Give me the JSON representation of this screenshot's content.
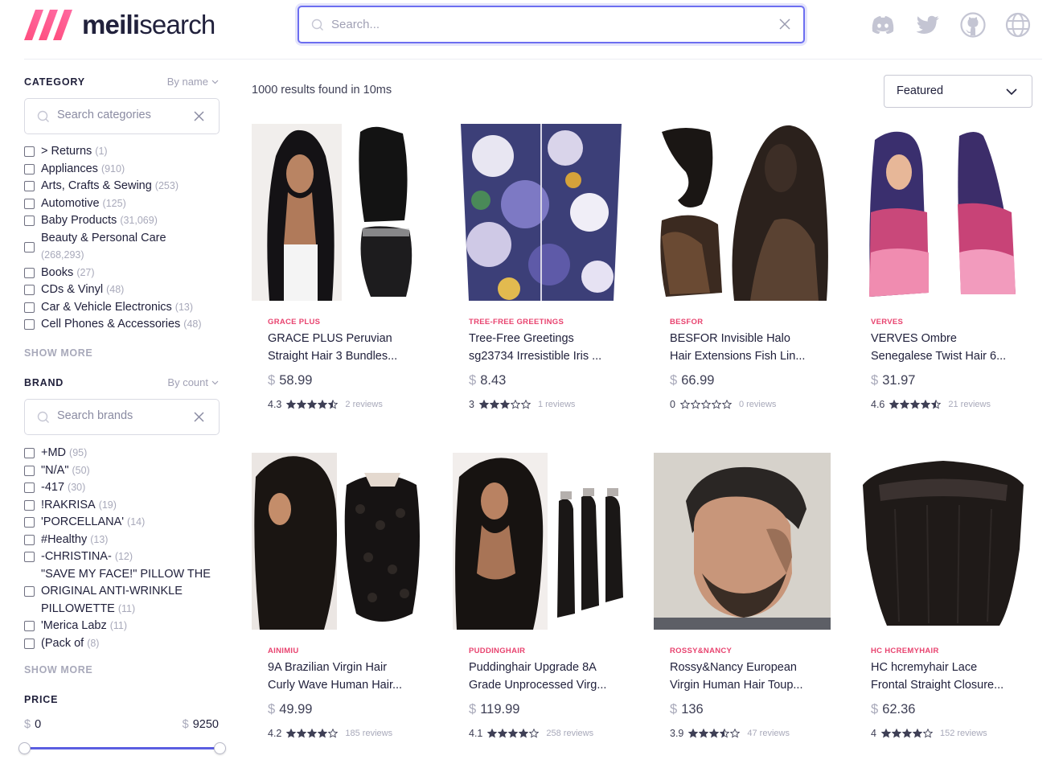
{
  "brand": {
    "wordmark_bold": "meili",
    "wordmark_light": "search",
    "colors": {
      "logo": "#ff5a8a",
      "accent": "#5b5ee1",
      "brand_text": "#e8436f"
    }
  },
  "search": {
    "placeholder": "Search...",
    "value": ""
  },
  "social": [
    {
      "icon": "discord-icon"
    },
    {
      "icon": "twitter-icon"
    },
    {
      "icon": "github-icon"
    },
    {
      "icon": "globe-icon"
    }
  ],
  "sidebar": {
    "category": {
      "title": "CATEGORY",
      "sort": "By name",
      "search_placeholder": "Search categories",
      "items": [
        {
          "label": "> Returns",
          "count": "(1)"
        },
        {
          "label": "Appliances",
          "count": "(910)"
        },
        {
          "label": "Arts, Crafts & Sewing",
          "count": "(253)"
        },
        {
          "label": "Automotive",
          "count": "(125)"
        },
        {
          "label": "Baby Products",
          "count": "(31,069)"
        },
        {
          "label": "Beauty & Personal Care",
          "count": "(268,293)"
        },
        {
          "label": "Books",
          "count": "(27)"
        },
        {
          "label": "CDs & Vinyl",
          "count": "(48)"
        },
        {
          "label": "Car & Vehicle Electronics",
          "count": "(13)"
        },
        {
          "label": "Cell Phones & Accessories",
          "count": "(48)"
        }
      ],
      "show_more": "SHOW MORE"
    },
    "brand": {
      "title": "BRAND",
      "sort": "By count",
      "search_placeholder": "Search brands",
      "items": [
        {
          "label": "+MD",
          "count": "(95)"
        },
        {
          "label": "\"N/A\"",
          "count": "(50)"
        },
        {
          "label": "-417",
          "count": "(30)"
        },
        {
          "label": "!RAKRISA",
          "count": "(19)"
        },
        {
          "label": "'PORCELLANA'",
          "count": "(14)"
        },
        {
          "label": "#Healthy",
          "count": "(13)"
        },
        {
          "label": "-CHRISTINA-",
          "count": "(12)"
        },
        {
          "label_lines": [
            "\"SAVE MY FACE!\" PILLOW THE",
            "ORIGINAL ANTI-WRINKLE",
            "PILLOWETTE"
          ],
          "count": "(11)"
        },
        {
          "label": "'Merica Labz",
          "count": "(11)"
        },
        {
          "label": "(Pack of",
          "count": "(8)"
        }
      ],
      "show_more": "SHOW MORE"
    },
    "price": {
      "title": "PRICE",
      "currency": "$",
      "min": "0",
      "max": "9250",
      "min_fraction": 0,
      "max_fraction": 1
    }
  },
  "results": {
    "count_text": "1000 results found in 10ms",
    "sort_value": "Featured"
  },
  "products": [
    {
      "brand": "GRACE PLUS",
      "title_lines": [
        "GRACE PLUS Peruvian",
        "Straight Hair 3 Bundles..."
      ],
      "currency": "$",
      "price": "58.99",
      "rating": "4.3",
      "stars": 4.5,
      "reviews": "2 reviews"
    },
    {
      "brand": "TREE-FREE GREETINGS",
      "title_lines": [
        "Tree-Free Greetings",
        "sg23734 Irresistible Iris ..."
      ],
      "currency": "$",
      "price": "8.43",
      "rating": "3",
      "stars": 3,
      "reviews": "1 reviews"
    },
    {
      "brand": "BESFOR",
      "title_lines": [
        "BESFOR Invisible Halo",
        "Hair Extensions Fish Lin..."
      ],
      "currency": "$",
      "price": "66.99",
      "rating": "0",
      "stars": 0,
      "reviews": "0 reviews"
    },
    {
      "brand": "VERVES",
      "title_lines": [
        "VERVES Ombre",
        "Senegalese Twist Hair 6..."
      ],
      "currency": "$",
      "price": "31.97",
      "rating": "4.6",
      "stars": 4.5,
      "reviews": "21 reviews"
    },
    {
      "brand": "AINIMIU",
      "title_lines": [
        "9A Brazilian Virgin Hair",
        "Curly Wave Human Hair..."
      ],
      "currency": "$",
      "price": "49.99",
      "rating": "4.2",
      "stars": 4,
      "reviews": "185 reviews"
    },
    {
      "brand": "PUDDINGHAIR",
      "title_lines": [
        "Puddinghair Upgrade 8A",
        "Grade Unprocessed Virg..."
      ],
      "currency": "$",
      "price": "119.99",
      "rating": "4.1",
      "stars": 4,
      "reviews": "258 reviews"
    },
    {
      "brand": "ROSSY&NANCY",
      "title_lines": [
        "Rossy&Nancy European",
        "Virgin Human Hair Toup..."
      ],
      "currency": "$",
      "price": "136",
      "rating": "3.9",
      "stars": 3.5,
      "reviews": "47 reviews"
    },
    {
      "brand": "HC HCREMYHAIR",
      "title_lines": [
        "HC hcremyhair Lace",
        "Frontal Straight Closure..."
      ],
      "currency": "$",
      "price": "62.36",
      "rating": "4",
      "stars": 4,
      "reviews": "152 reviews"
    }
  ]
}
